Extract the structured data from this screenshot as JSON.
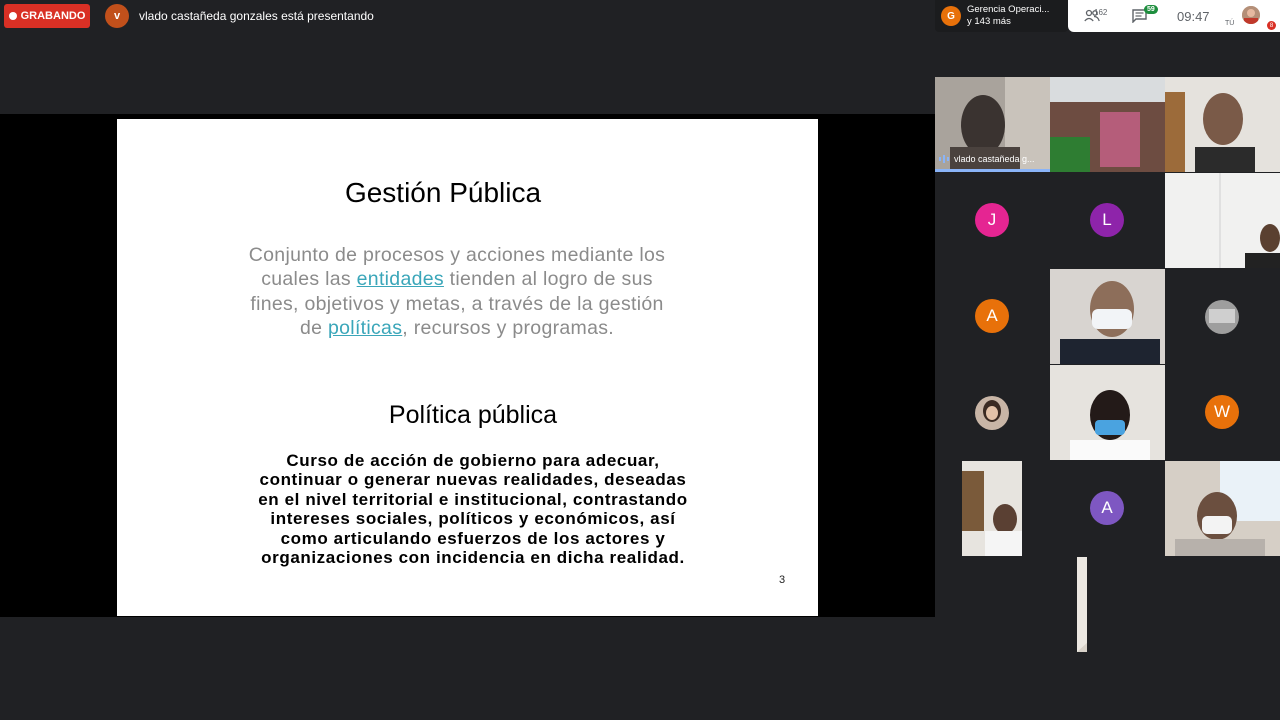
{
  "topbar": {
    "recording_label": "GRABANDO",
    "presenter_initial": "v",
    "presenter_text": "vlado castañeda gonzales está presentando"
  },
  "meeting": {
    "initial": "G",
    "name_line1": "Gerencia Operaci...",
    "name_line2": "y 143 más"
  },
  "status": {
    "people_count": "162",
    "chat_count": "59",
    "time": "09:47",
    "self_label": "TÚ",
    "self_badge": "8"
  },
  "slide": {
    "title": "Gestión Pública",
    "para1_a": "Conjunto de procesos y acciones mediante los cuales las ",
    "link1": "entidades",
    "para1_b": " tienden al logro de sus fines, objetivos y metas, a través de la gestión de ",
    "link2": "políticas",
    "para1_c": ", recursos y programas.",
    "subtitle": "Política pública",
    "para2": "Curso de acción de gobierno para adecuar, continuar o generar nuevas realidades, deseadas en el nivel territorial e institucional, contrastando intereses sociales, políticos y económicos, así como articulando esfuerzos de los actores y organizaciones con incidencia en dicha realidad.",
    "page_number": "3"
  },
  "participants": {
    "speaker_name": "vlado castañeda g...",
    "initials": {
      "j": "J",
      "l": "L",
      "a1": "A",
      "w": "W",
      "a2": "A"
    },
    "colors": {
      "j": "#e52592",
      "l": "#8e24aa",
      "a1": "#e8710a",
      "w": "#e8710a",
      "a2": "#7e57c2"
    }
  }
}
